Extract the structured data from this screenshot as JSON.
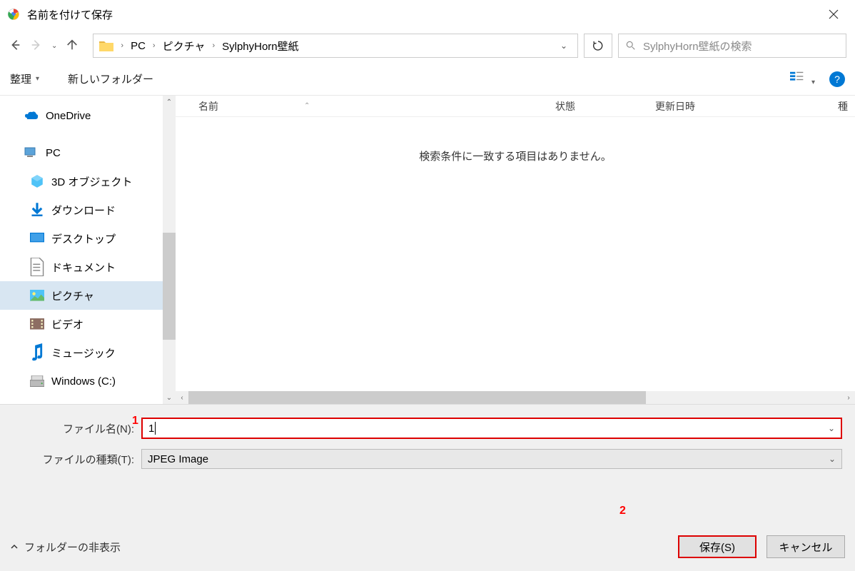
{
  "window": {
    "title": "名前を付けて保存"
  },
  "breadcrumb": {
    "pc": "PC",
    "pictures": "ピクチャ",
    "folder": "SylphyHorn壁紙"
  },
  "search": {
    "placeholder": "SylphyHorn壁紙の検索"
  },
  "toolbar": {
    "organize": "整理",
    "new_folder": "新しいフォルダー"
  },
  "columns": {
    "name": "名前",
    "status": "状態",
    "date": "更新日時",
    "type": "種"
  },
  "tree": {
    "onedrive": "OneDrive",
    "pc": "PC",
    "3d_objects": "3D オブジェクト",
    "downloads": "ダウンロード",
    "desktop": "デスクトップ",
    "documents": "ドキュメント",
    "pictures": "ピクチャ",
    "videos": "ビデオ",
    "music": "ミュージック",
    "c_drive": "Windows (C:)"
  },
  "filelist": {
    "empty": "検索条件に一致する項目はありません。"
  },
  "form": {
    "filename_label": "ファイル名(N):",
    "filename_value": "1",
    "filetype_label": "ファイルの種類(T):",
    "filetype_value": "JPEG Image"
  },
  "footer": {
    "hide_folders": "フォルダーの非表示",
    "save": "保存(S)",
    "cancel": "キャンセル"
  },
  "annotations": {
    "one": "1",
    "two": "2"
  }
}
